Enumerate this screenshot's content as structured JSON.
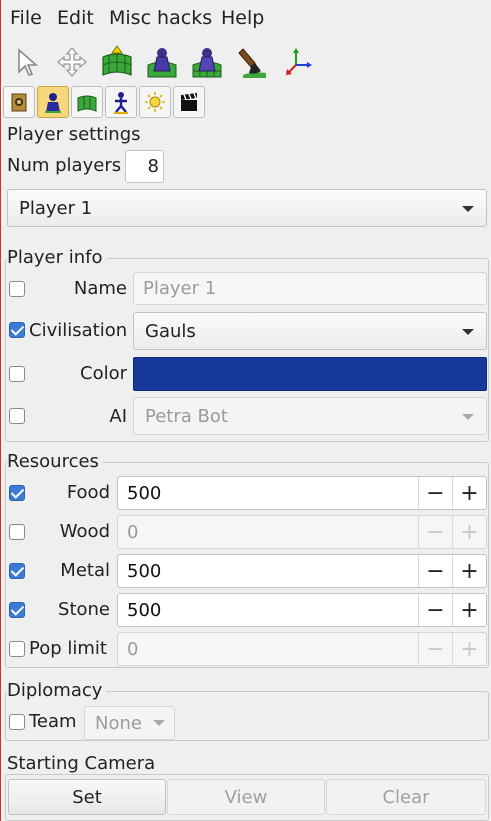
{
  "menu": [
    "File",
    "Edit",
    "Misc hacks",
    "Help"
  ],
  "toolbar_icons": [
    "select-arrow-icon",
    "move-icon",
    "terrain-raise-icon",
    "player-unit-icon",
    "player-unit-grid-icon",
    "paint-brush-icon",
    "axes-icon"
  ],
  "tabs": [
    "map-settings-icon",
    "player-icon",
    "terrain-icon",
    "object-icon",
    "environment-icon",
    "cinematic-icon"
  ],
  "player_settings": {
    "title": "Player settings",
    "num_players_label": "Num players",
    "num_players_value": "8",
    "player_select": "Player 1"
  },
  "player_info": {
    "title": "Player info",
    "name_label": "Name",
    "name_placeholder": "Player 1",
    "name_checked": false,
    "civ_label": "Civilisation",
    "civ_value": "Gauls",
    "civ_checked": true,
    "color_label": "Color",
    "color_checked": false,
    "color_value": "#17399a",
    "ai_label": "AI",
    "ai_value": "Petra Bot",
    "ai_checked": false
  },
  "resources": {
    "title": "Resources",
    "items": [
      {
        "label": "Food",
        "value": "500",
        "checked": true
      },
      {
        "label": "Wood",
        "value": "0",
        "checked": false
      },
      {
        "label": "Metal",
        "value": "500",
        "checked": true
      },
      {
        "label": "Stone",
        "value": "500",
        "checked": true
      },
      {
        "label": "Pop limit",
        "value": "0",
        "checked": false
      }
    ],
    "minus": "−",
    "plus": "+"
  },
  "diplomacy": {
    "title": "Diplomacy",
    "team_label": "Team",
    "team_value": "None",
    "team_checked": false
  },
  "camera": {
    "title": "Starting Camera",
    "set_label": "Set",
    "view_label": "View",
    "clear_label": "Clear"
  }
}
